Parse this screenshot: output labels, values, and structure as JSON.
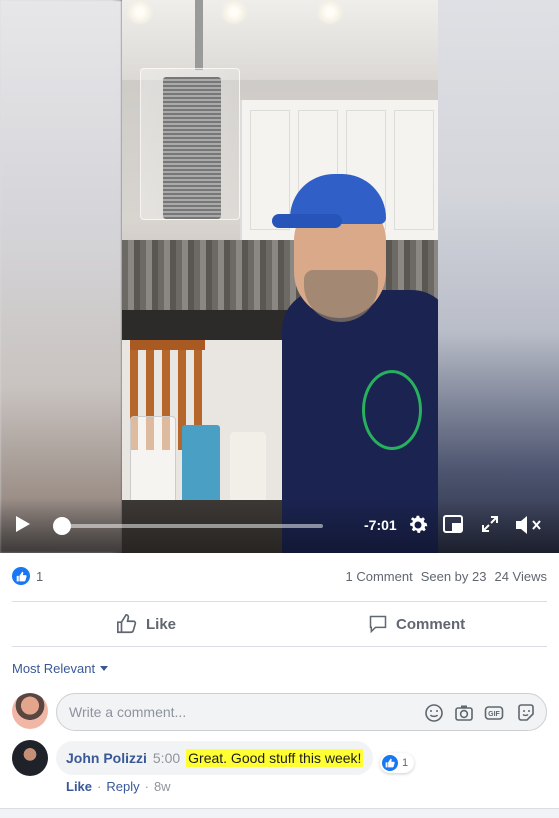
{
  "video": {
    "time_remaining": "-7:01",
    "progress": 0.02,
    "icons": {
      "play": "play-icon",
      "settings": "gear-icon",
      "pip": "picture-in-picture-icon",
      "fullscreen": "expand-icon",
      "mute": "volume-muted-icon"
    }
  },
  "stats": {
    "like_count": "1",
    "comments": "1 Comment",
    "seen_by": "Seen by 23",
    "views": "24 Views"
  },
  "actions": {
    "like_label": "Like",
    "comment_label": "Comment"
  },
  "comments": {
    "sort_label": "Most Relevant",
    "composer_placeholder": "Write a comment...",
    "composer_icons": [
      "emoji-icon",
      "camera-icon",
      "gif-icon",
      "sticker-icon"
    ],
    "items": [
      {
        "author": "John Polizzi",
        "timestamp": "5:00",
        "text": "Great. Good stuff this week!",
        "reaction_count": "1",
        "like_action": "Like",
        "reply_action": "Reply",
        "age": "8w"
      }
    ]
  },
  "colors": {
    "facebook_blue": "#1877f2",
    "link_blue": "#385898",
    "highlight_yellow": "#ffff33",
    "muted_gray": "#606770"
  }
}
